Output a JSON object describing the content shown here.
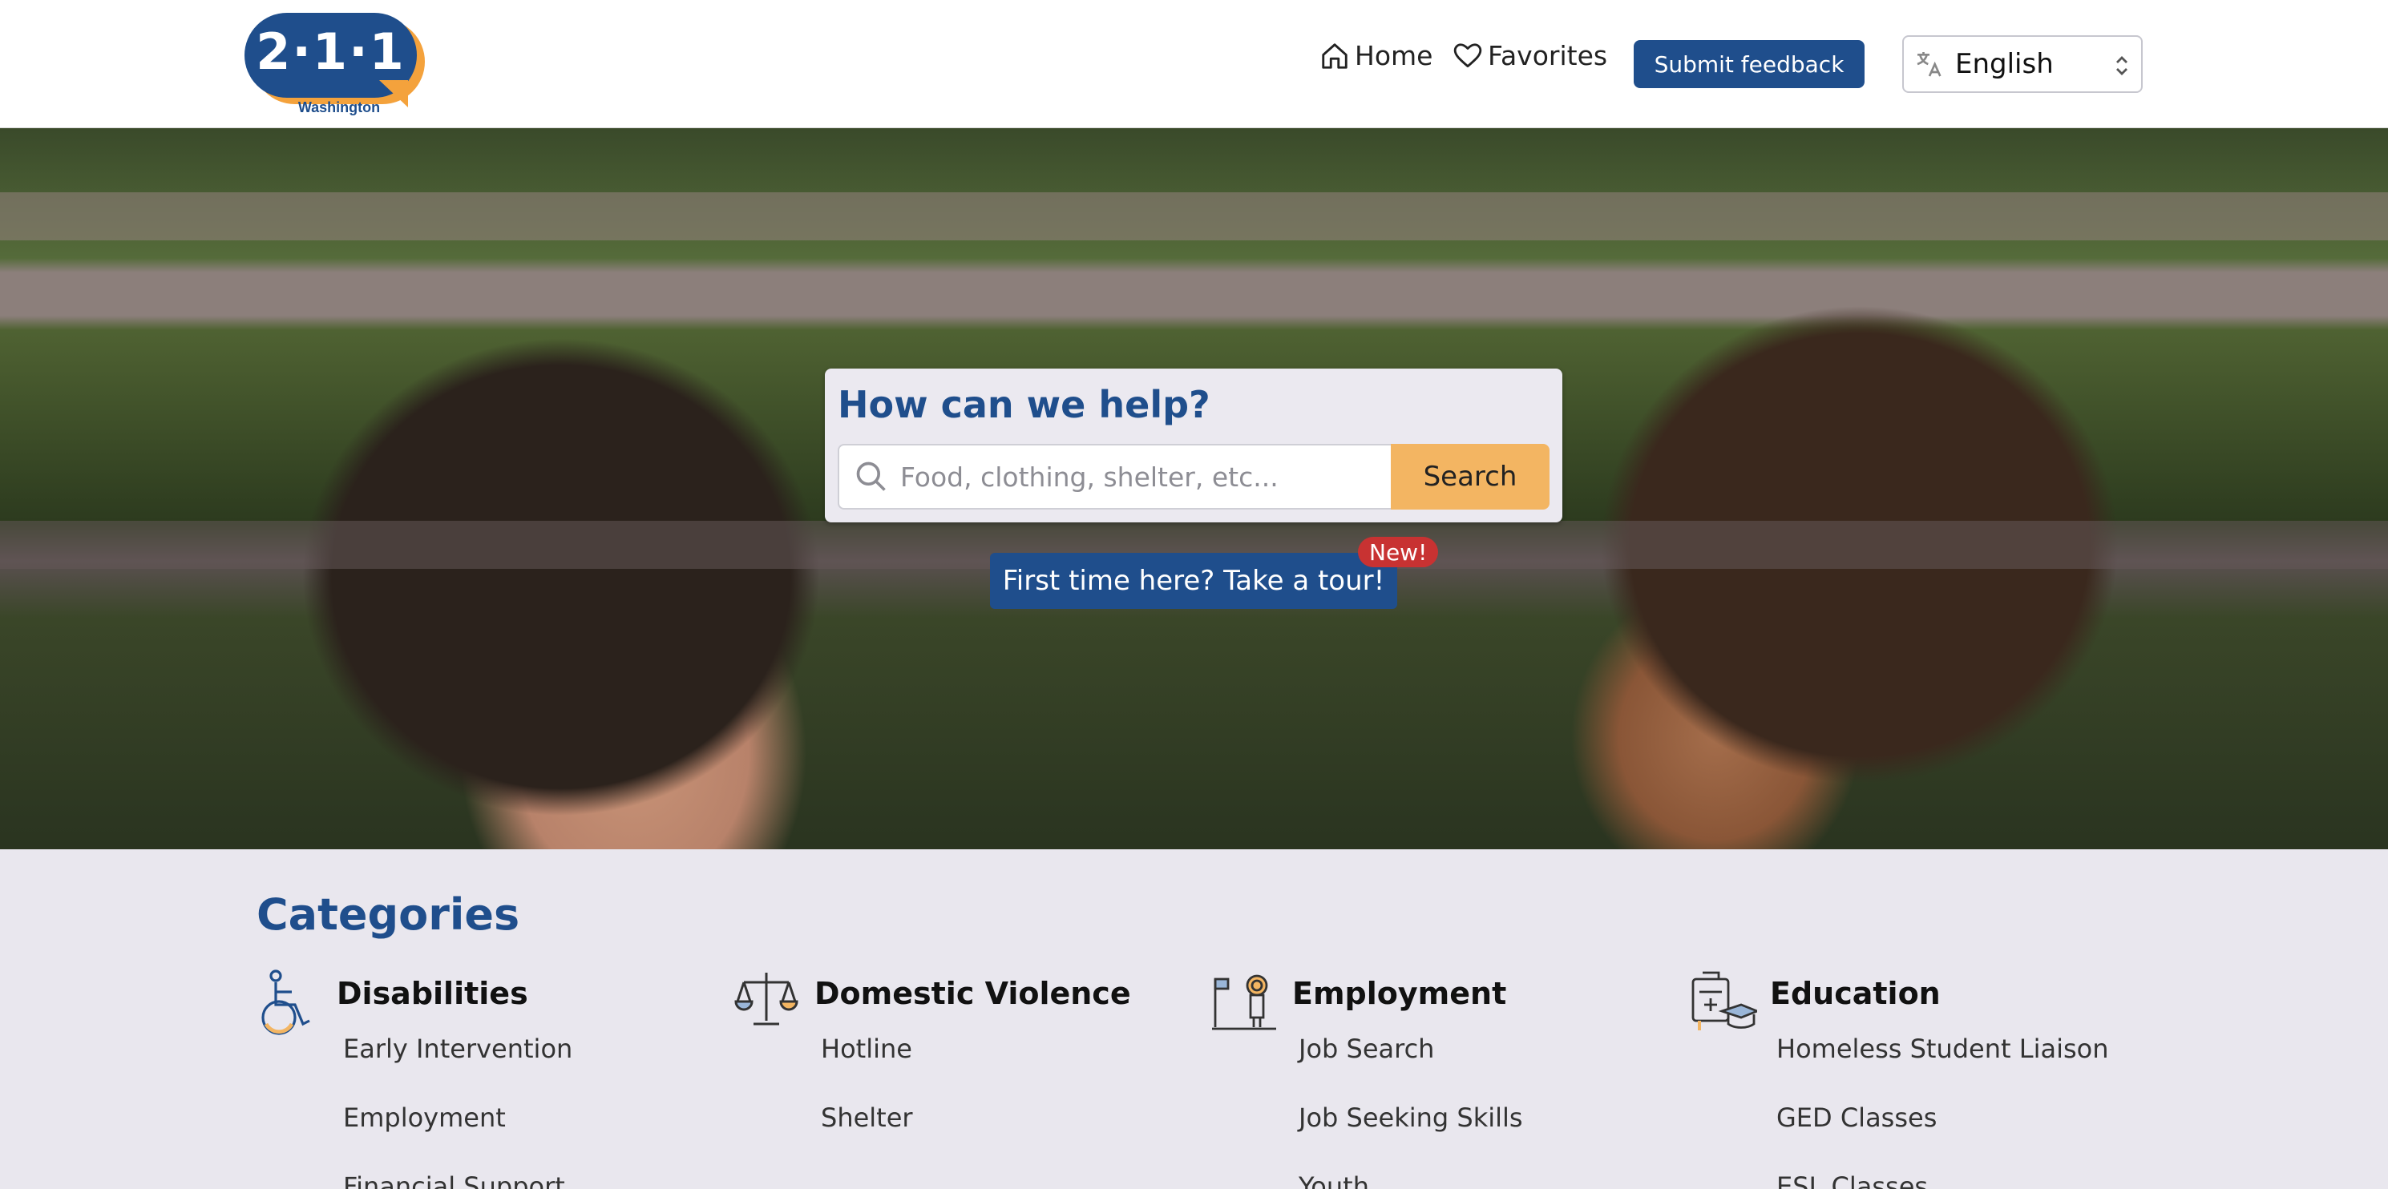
{
  "header": {
    "logo_number": "2·1·1",
    "logo_subtitle": "Washington",
    "nav_home": "Home",
    "nav_favorites": "Favorites",
    "feedback_button": "Submit feedback",
    "language_selected": "English"
  },
  "hero": {
    "search_title": "How can we help?",
    "search_placeholder": "Food, clothing, shelter, etc...",
    "search_button": "Search",
    "tour_button": "First time here? Take a tour!",
    "new_badge": "New!"
  },
  "categories": {
    "heading": "Categories",
    "columns": [
      {
        "title": "Disabilities",
        "icon": "wheelchair-icon",
        "items": [
          "Early Intervention",
          "Employment",
          "Financial Support"
        ]
      },
      {
        "title": "Domestic Violence",
        "icon": "scales-icon",
        "items": [
          "Hotline",
          "Shelter"
        ]
      },
      {
        "title": "Employment",
        "icon": "worker-icon",
        "items": [
          "Job Search",
          "Job Seeking Skills",
          "Youth"
        ]
      },
      {
        "title": "Education",
        "icon": "school-supplies-icon",
        "items": [
          "Homeless Student Liaison",
          "GED Classes",
          "ESL Classes"
        ]
      }
    ]
  },
  "colors": {
    "primary": "#1f4e8c",
    "accent": "#f3b562",
    "badge": "#c83232",
    "background": "#e9e7ee"
  }
}
